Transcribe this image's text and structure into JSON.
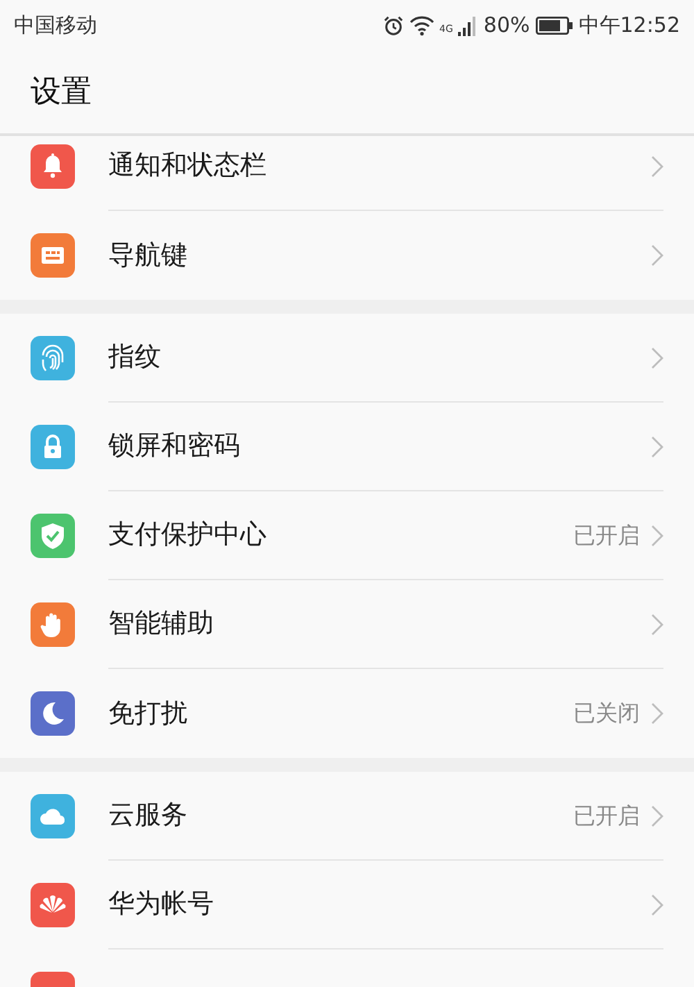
{
  "status_bar": {
    "carrier": "中国移动",
    "network": "4G",
    "battery": "80%",
    "time": "中午12:52"
  },
  "title": "设置",
  "groups": [
    [
      {
        "kind": "bell",
        "color": "#f0574b",
        "label": "通知和状态栏"
      },
      {
        "kind": "navkey",
        "color": "#f27b3a",
        "label": "导航键"
      }
    ],
    [
      {
        "kind": "fingerprint",
        "color": "#3fb2de",
        "label": "指纹"
      },
      {
        "kind": "lock",
        "color": "#3fb2de",
        "label": "锁屏和密码"
      },
      {
        "kind": "shield",
        "color": "#4cc46e",
        "label": "支付保护中心",
        "value": "已开启"
      },
      {
        "kind": "hand",
        "color": "#f27b3a",
        "label": "智能辅助"
      },
      {
        "kind": "moon",
        "color": "#5b6fc9",
        "label": "免打扰",
        "value": "已关闭"
      }
    ],
    [
      {
        "kind": "cloud",
        "color": "#3fb2de",
        "label": "云服务",
        "value": "已开启"
      },
      {
        "kind": "petals",
        "color": "#f0574b",
        "label": "华为帐号"
      },
      {
        "kind": "blank",
        "color": "#f0574b"
      }
    ]
  ]
}
